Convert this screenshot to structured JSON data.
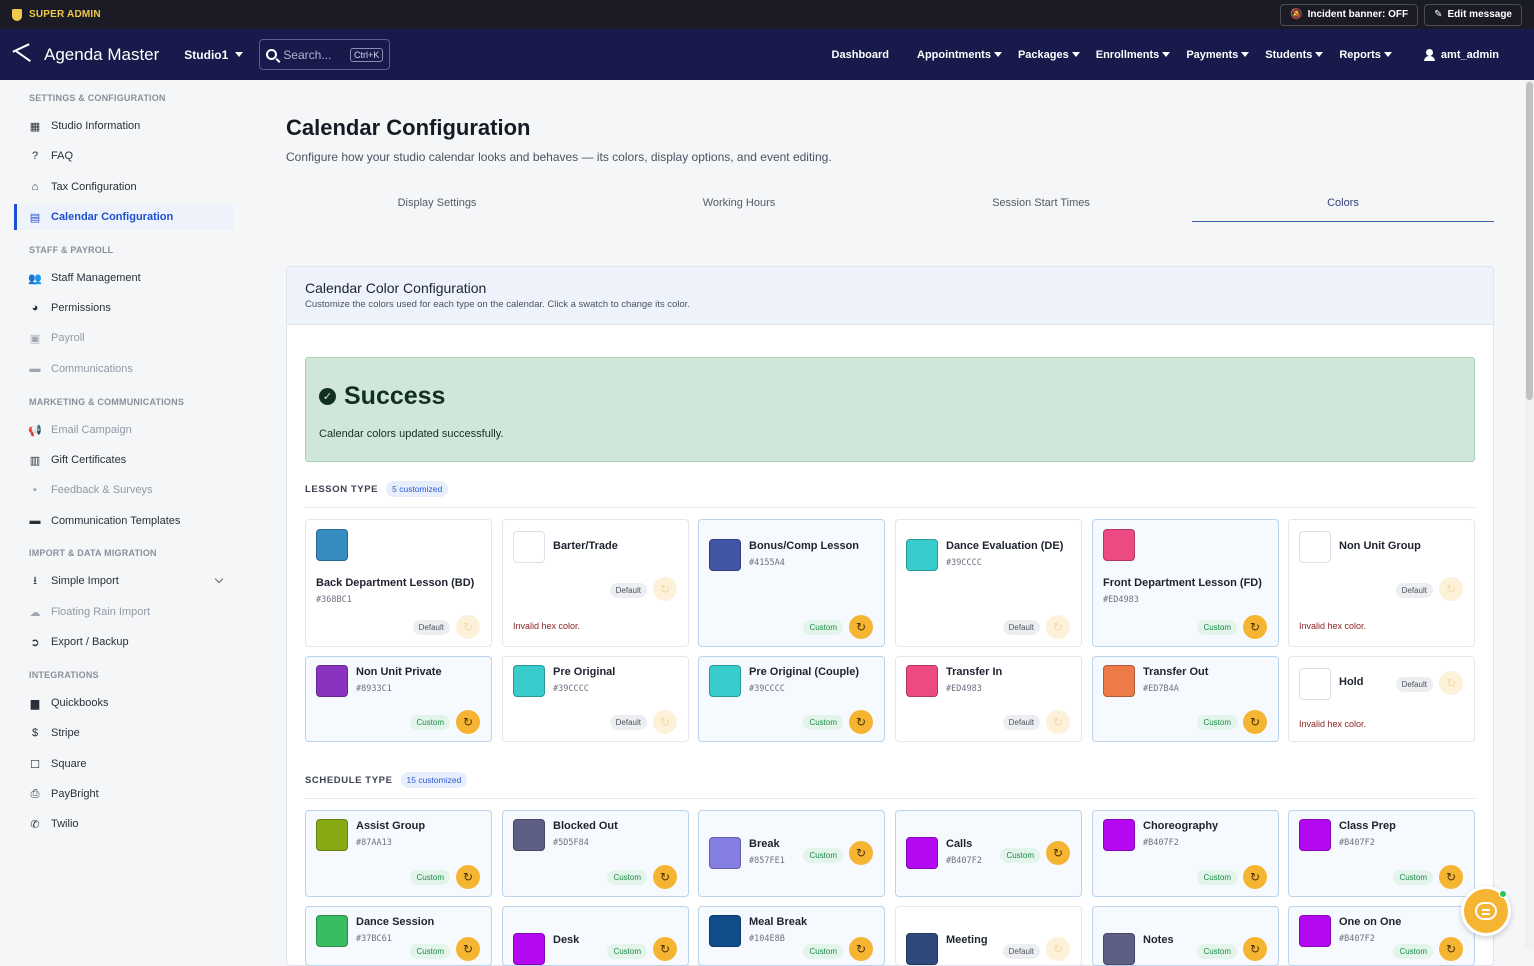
{
  "adminbar": {
    "role": "SUPER ADMIN",
    "incident": "Incident banner: OFF",
    "edit": "Edit message"
  },
  "navbar": {
    "app": "Agenda Master",
    "studio": "Studio1",
    "search_placeholder": "Search...",
    "search_shortcut": "Ctrl+K",
    "items": [
      "Dashboard",
      "Appointments",
      "Packages",
      "Enrollments",
      "Payments",
      "Students",
      "Reports"
    ],
    "user": "amt_admin"
  },
  "sidebar": {
    "sections": [
      "SETTINGS & CONFIGURATION",
      "STAFF & PAYROLL",
      "MARKETING & COMMUNICATIONS",
      "IMPORT & DATA MIGRATION",
      "INTEGRATIONS"
    ],
    "items": [
      {
        "label": "Studio Information",
        "icon": "store-icon"
      },
      {
        "label": "FAQ",
        "icon": "help-icon"
      },
      {
        "label": "Tax Configuration",
        "icon": "bank-icon"
      },
      {
        "label": "Calendar Configuration",
        "icon": "calendar-icon"
      },
      {
        "label": "Staff Management",
        "icon": "people-icon"
      },
      {
        "label": "Permissions",
        "icon": "lock-icon"
      },
      {
        "label": "Payroll",
        "icon": "payroll-icon"
      },
      {
        "label": "Communications",
        "icon": "chat-icon"
      },
      {
        "label": "Email Campaign",
        "icon": "megaphone-icon"
      },
      {
        "label": "Gift Certificates",
        "icon": "gift-icon"
      },
      {
        "label": "Feedback & Surveys",
        "icon": "feedback-icon"
      },
      {
        "label": "Communication Templates",
        "icon": "template-icon"
      },
      {
        "label": "Simple Import",
        "icon": "download-icon"
      },
      {
        "label": "Floating Rain Import",
        "icon": "cloud-icon"
      },
      {
        "label": "Export / Backup",
        "icon": "export-icon"
      },
      {
        "label": "Quickbooks",
        "icon": "document-icon"
      },
      {
        "label": "Stripe",
        "icon": "stripe-icon"
      },
      {
        "label": "Square",
        "icon": "square-icon"
      },
      {
        "label": "PayBright",
        "icon": "printer-icon"
      },
      {
        "label": "Twilio",
        "icon": "phone-icon"
      }
    ]
  },
  "page": {
    "title": "Calendar Configuration",
    "subtitle": "Configure how your studio calendar looks and behaves — its colors, display options, and event editing.",
    "tabs": [
      "Display Settings",
      "Working Hours",
      "Session Start Times",
      "Colors"
    ],
    "active_tab": "Colors"
  },
  "panel": {
    "title": "Calendar Color Configuration",
    "subtitle": "Customize the colors used for each type on the calendar. Click a swatch to change its color."
  },
  "alert": {
    "title": "Success",
    "message": "Calendar colors updated successfully."
  },
  "labels": {
    "default": "Default",
    "custom": "Custom",
    "invalid": "Invalid hex color."
  },
  "lesson_type": {
    "label": "LESSON TYPE",
    "count": "5 customized",
    "cards": [
      {
        "name": "Back Department Lesson (BD)",
        "hex": "#368BC1",
        "status": "Default"
      },
      {
        "name": "Barter/Trade",
        "hex": "",
        "status": "Default",
        "error": "Invalid hex color."
      },
      {
        "name": "Bonus/Comp Lesson",
        "hex": "#4155A4",
        "status": "Custom"
      },
      {
        "name": "Dance Evaluation (DE)",
        "hex": "#39CCCC",
        "status": "Default"
      },
      {
        "name": "Front Department Lesson (FD)",
        "hex": "#ED4983",
        "status": "Custom"
      },
      {
        "name": "Non Unit Group",
        "hex": "",
        "status": "Default",
        "error": "Invalid hex color."
      },
      {
        "name": "Non Unit Private",
        "hex": "#8933C1",
        "status": "Custom"
      },
      {
        "name": "Pre Original",
        "hex": "#39CCCC",
        "status": "Default"
      },
      {
        "name": "Pre Original (Couple)",
        "hex": "#39CCCC",
        "status": "Custom"
      },
      {
        "name": "Transfer In",
        "hex": "#ED4983",
        "status": "Default"
      },
      {
        "name": "Transfer Out",
        "hex": "#ED7B4A",
        "status": "Custom"
      },
      {
        "name": "Hold",
        "hex": "",
        "status": "Default",
        "error": "Invalid hex color."
      }
    ]
  },
  "schedule_type": {
    "label": "SCHEDULE TYPE",
    "count": "15 customized",
    "cards": [
      {
        "name": "Assist Group",
        "hex": "#87AA13",
        "status": "Custom"
      },
      {
        "name": "Blocked Out",
        "hex": "#5D5F84",
        "status": "Custom"
      },
      {
        "name": "Break",
        "hex": "#857FE1",
        "status": "Custom"
      },
      {
        "name": "Calls",
        "hex": "#B407F2",
        "status": "Custom"
      },
      {
        "name": "Choreography",
        "hex": "#B407F2",
        "status": "Custom"
      },
      {
        "name": "Class Prep",
        "hex": "#B407F2",
        "status": "Custom"
      },
      {
        "name": "Dance Session",
        "hex": "#37BC61",
        "status": "Custom"
      },
      {
        "name": "Desk",
        "hex": "",
        "color": "#B407F2",
        "status": "Custom"
      },
      {
        "name": "Meal Break",
        "hex": "#104E8B",
        "status": "Custom"
      },
      {
        "name": "Meeting",
        "hex": "",
        "color": "#2E4A7A",
        "status": "Default"
      },
      {
        "name": "Notes",
        "hex": "",
        "color": "#5D5F84",
        "status": "Custom"
      },
      {
        "name": "One on One",
        "hex": "#B407F2",
        "status": "Custom"
      }
    ]
  },
  "colors": {
    "accent": "#1F4FD1",
    "navbar": "#171A4A",
    "reset": "#F5B432",
    "success_bg": "#CFE6D9"
  }
}
